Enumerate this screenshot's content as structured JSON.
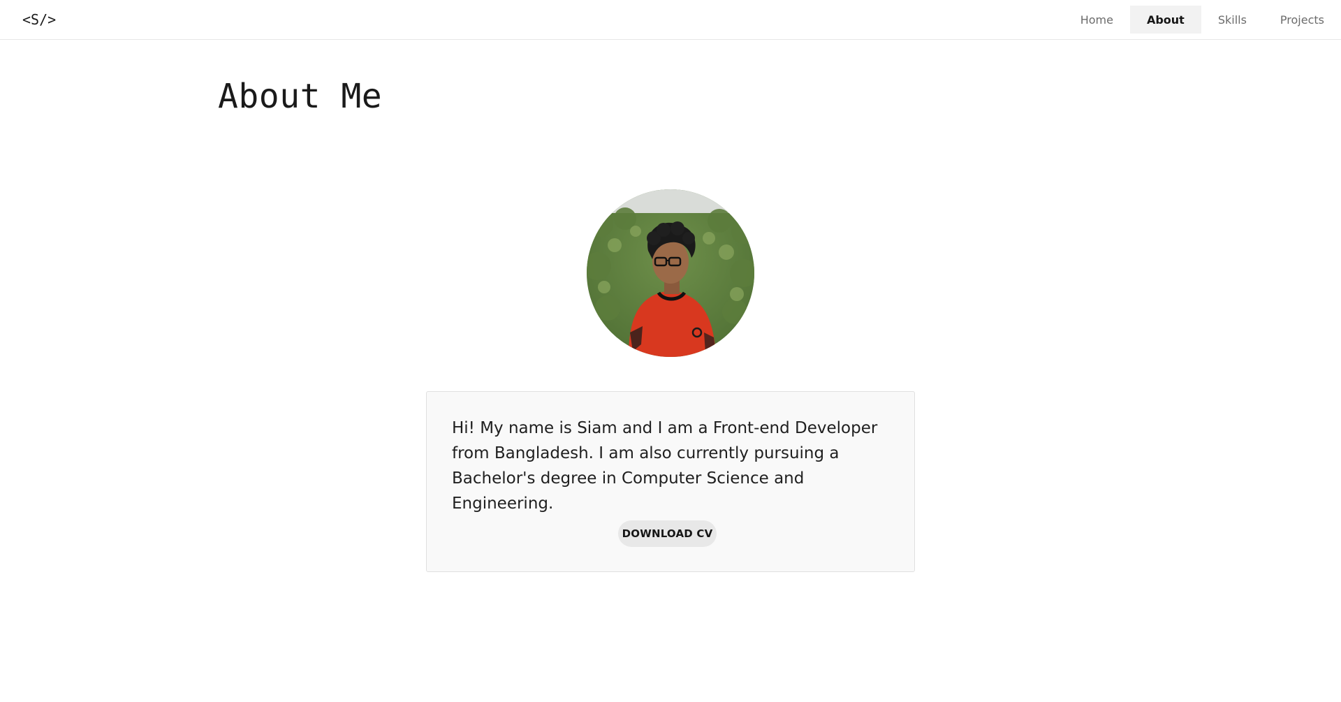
{
  "header": {
    "logo": "<S/>",
    "nav": [
      {
        "label": "Home",
        "active": false
      },
      {
        "label": "About",
        "active": true
      },
      {
        "label": "Skills",
        "active": false
      },
      {
        "label": "Projects",
        "active": false
      }
    ]
  },
  "main": {
    "title": "About Me",
    "avatar_icon": "profile-photo",
    "bio": "Hi! My name is Siam and I am a Front-end Developer from Bangladesh. I am also currently pursuing a Bachelor's degree in Computer Science and Engineering.",
    "cv_button_label": "DOWNLOAD CV"
  },
  "colors": {
    "nav_active_bg": "#f2f2f2",
    "card_bg": "#f9f9f9",
    "button_bg": "#e8e8e8",
    "text": "#1a1a1a"
  }
}
